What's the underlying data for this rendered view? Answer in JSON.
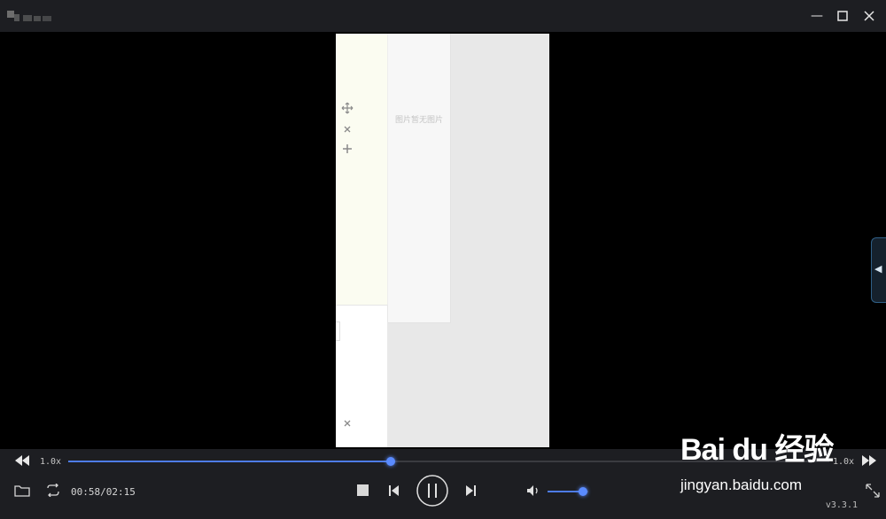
{
  "video": {
    "panel_text": "图片暂无图片"
  },
  "player": {
    "speed_left": "1.0x",
    "speed_right": "1.0x",
    "progress_fraction": 0.424,
    "time_text": "00:58/02:15",
    "volume_fraction": 0.88,
    "version": "v3.3.1"
  },
  "watermark": {
    "brand": "Bai du 经验",
    "site": "jingyan.baidu.com"
  },
  "colors": {
    "accent": "#4e7ce8",
    "bar_bg": "#1d1e22"
  }
}
